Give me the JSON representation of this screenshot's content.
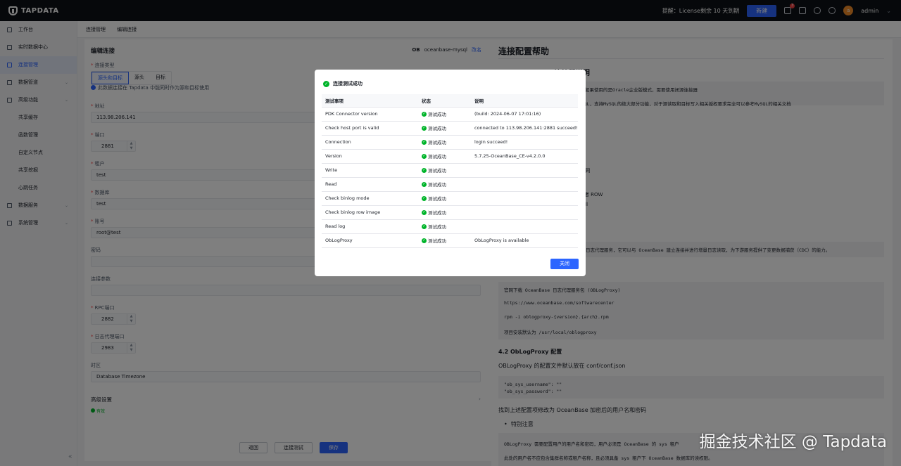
{
  "brand": "TAPDATA",
  "topbar": {
    "notice": "提醒：License剩余 10 天到期",
    "new_button": "新建",
    "badge": "3",
    "user": "admin",
    "avatar_letter": "a"
  },
  "sidebar": {
    "items": [
      {
        "label": "工作台",
        "icon": "dashboard-icon"
      },
      {
        "label": "实时数据中心",
        "icon": "data-center-icon"
      },
      {
        "label": "连接管理",
        "icon": "connection-icon",
        "active": true
      },
      {
        "label": "数据管道",
        "icon": "pipeline-icon",
        "caret": true
      },
      {
        "label": "高级功能",
        "icon": "advanced-icon",
        "caret": true
      },
      {
        "label": "共享缓存",
        "sub": true
      },
      {
        "label": "函数管理",
        "sub": true
      },
      {
        "label": "自定义节点",
        "sub": true
      },
      {
        "label": "共享挖掘",
        "sub": true
      },
      {
        "label": "心跳任务",
        "sub": true
      },
      {
        "label": "数据服务",
        "icon": "data-service-icon",
        "caret": true
      },
      {
        "label": "系统管理",
        "icon": "system-icon",
        "caret": true
      }
    ]
  },
  "breadcrumb": [
    "连接管理",
    "编辑连接"
  ],
  "form": {
    "title": "编辑连接",
    "connector_logo": "OB",
    "connector_name": "oceanbase-mysql",
    "rename": "改名",
    "conn_type_label": "连接类型",
    "conn_types": [
      "源头和目标",
      "源头",
      "目标"
    ],
    "conn_tip": "此数据连接在 Tapdata 中能同时作为源和目标使用",
    "host_label": "地址",
    "host": "113.98.206.141",
    "port_label": "端口",
    "port": "2881",
    "tenant_label": "租户",
    "tenant": "test",
    "db_label": "数据库",
    "db": "test",
    "user_label": "账号",
    "user": "root@test",
    "password_label": "密码",
    "params_label": "连接参数",
    "rpc_label": "RPC端口",
    "rpc": "2882",
    "logproxy_label": "日志代理端口",
    "logproxy": "2983",
    "tz_label": "时区",
    "tz": "Database Timezone",
    "adv_label": "高级设置",
    "valid": "有效",
    "back": "返回",
    "test": "连接测试",
    "save": "保存"
  },
  "help": {
    "title": "连接配置帮助",
    "sub": "1. OceanBase 连接器说明",
    "box1_line1": "式，如果使用的是Oracle企业版模式，需要使用闭源连接器",
    "box1_line2": "MySQL，支持MySQL的绝大部分功能，对于源读取和目标写入相关授权要求完全可以参考MySQL的相关文档",
    "l1": "QL相同",
    "l2": "w 或者 ROW",
    "l3": "为 full",
    "box2": "日志代理服务，它可以与 OceanBase 建立连接并进行增量日志读取，为下游服务提供了变更数据捕获（CDC）的能力。",
    "code_lines": [
      "官网下载 OceanBase 日志代理服务包 (OBLogProxy)",
      "https://www.oceanbase.com/softwarecenter",
      "rpm -i oblogproxy-{version}.{arch}.rpm",
      "项目安装默认为 /usr/local/oblogproxy"
    ],
    "h42": "4.2 ObLogProxy 配置",
    "p42": "OBLogProxy 的配置文件默认放在 conf/conf.json",
    "code2": [
      "\"ob_sys_username\": \"\"",
      "\"ob_sys_password\": \"\""
    ],
    "p_enc": "找到上述配置项修改为 OceanBase 加密后的用户名和密码",
    "li_note": "特别注意",
    "box3_line1": "OBLogProxy 需要配置用户的用户名和密码，用户必须是 OceanBase 的 sys 租户",
    "box3_line2": "此处的用户名不应包含集群名称或租户名称，且必须具备 sys 租户下 OceanBase 数据库的读权限。"
  },
  "modal": {
    "title": "连接测试成功",
    "headers": [
      "测试事项",
      "状态",
      "说明"
    ],
    "rows": [
      {
        "item": "PDK Connector version",
        "status": "测试成功",
        "desc": "(build: 2024-06-07 17:01:16)"
      },
      {
        "item": "Check host port is valid",
        "status": "测试成功",
        "desc": "connected to 113.98.206.141:2881 succeed!"
      },
      {
        "item": "Connection",
        "status": "测试成功",
        "desc": "login succeed!"
      },
      {
        "item": "Version",
        "status": "测试成功",
        "desc": "5.7.25-OceanBase_CE-v4.2.0.0"
      },
      {
        "item": "Write",
        "status": "测试成功",
        "desc": ""
      },
      {
        "item": "Read",
        "status": "测试成功",
        "desc": ""
      },
      {
        "item": "Check binlog mode",
        "status": "测试成功",
        "desc": ""
      },
      {
        "item": "Check binlog row image",
        "status": "测试成功",
        "desc": ""
      },
      {
        "item": "Read log",
        "status": "测试成功",
        "desc": ""
      },
      {
        "item": "ObLogProxy",
        "status": "测试成功",
        "desc": "ObLogProxy is available"
      }
    ],
    "close": "关闭"
  },
  "watermark": "掘金技术社区 @ Tapdata"
}
